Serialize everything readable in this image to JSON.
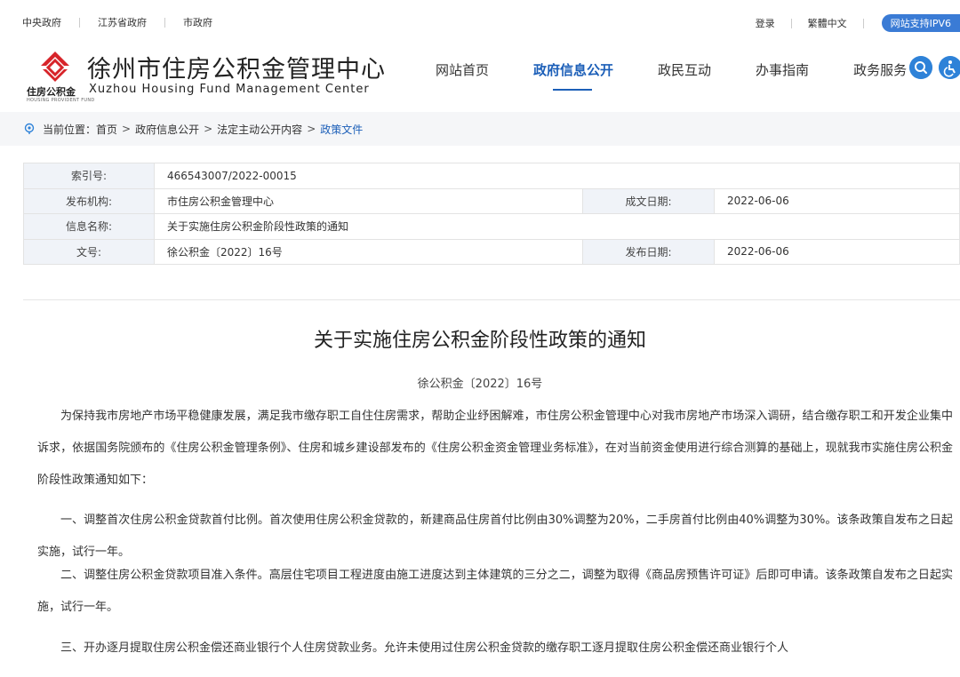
{
  "topbar": {
    "links": [
      "中央政府",
      "江苏省政府",
      "市政府"
    ],
    "login": "登录",
    "traditional": "繁體中文",
    "ipv6": "网站支持IPV6"
  },
  "header": {
    "title": "徐州市住房公积金管理中心",
    "sub_cn": "住房公积金",
    "sub_en": "Xuzhou Housing Fund Management Center",
    "sub_tiny": "HOUSING PROVIDENT FUND",
    "nav": [
      "网站首页",
      "政府信息公开",
      "政民互动",
      "办事指南",
      "政务服务"
    ],
    "active_nav": "政府信息公开"
  },
  "breadcrumb": {
    "prefix": "当前位置：",
    "items": [
      "首页",
      "政府信息公开",
      "法定主动公开内容"
    ],
    "current": "政策文件"
  },
  "info": {
    "index_label": "索引号:",
    "index_value": "466543007/2022-00015",
    "publisher_label": "发布机构:",
    "publisher_value": "市住房公积金管理中心",
    "created_label": "成文日期:",
    "created_value": "2022-06-06",
    "name_label": "信息名称:",
    "name_value": "关于实施住房公积金阶段性政策的通知",
    "docno_label": "文号:",
    "docno_value": "徐公积金〔2022〕16号",
    "published_label": "发布日期:",
    "published_value": "2022-06-06"
  },
  "article": {
    "title": "关于实施住房公积金阶段性政策的通知",
    "doc_number": "徐公积金〔2022〕16号",
    "paragraphs": [
      "为保持我市房地产市场平稳健康发展，满足我市缴存职工自住住房需求，帮助企业纾困解难，市住房公积金管理中心对我市房地产市场深入调研，结合缴存职工和开发企业集中诉求，依据国务院颁布的《住房公积金管理条例》、住房和城乡建设部发布的《住房公积金资金管理业务标准》，在对当前资金使用进行综合测算的基础上，现就我市实施住房公积金阶段性政策通知如下：",
      "一、调整首次住房公积金贷款首付比例。首次使用住房公积金贷款的，新建商品住房首付比例由30%调整为20%，二手房首付比例由40%调整为30%。该条政策自发布之日起实施，试行一年。",
      "二、调整住房公积金贷款项目准入条件。高层住宅项目工程进度由施工进度达到主体建筑的三分之二，调整为取得《商品房预售许可证》后即可申请。该条政策自发布之日起实施，试行一年。",
      "三、开办逐月提取住房公积金偿还商业银行个人住房贷款业务。允许未使用过住房公积金贷款的缴存职工逐月提取住房公积金偿还商业银行个人"
    ]
  },
  "colors": {
    "accent": "#1c5fb8",
    "logo_red": "#d7242a",
    "label_bg": "#f0f3f8"
  }
}
